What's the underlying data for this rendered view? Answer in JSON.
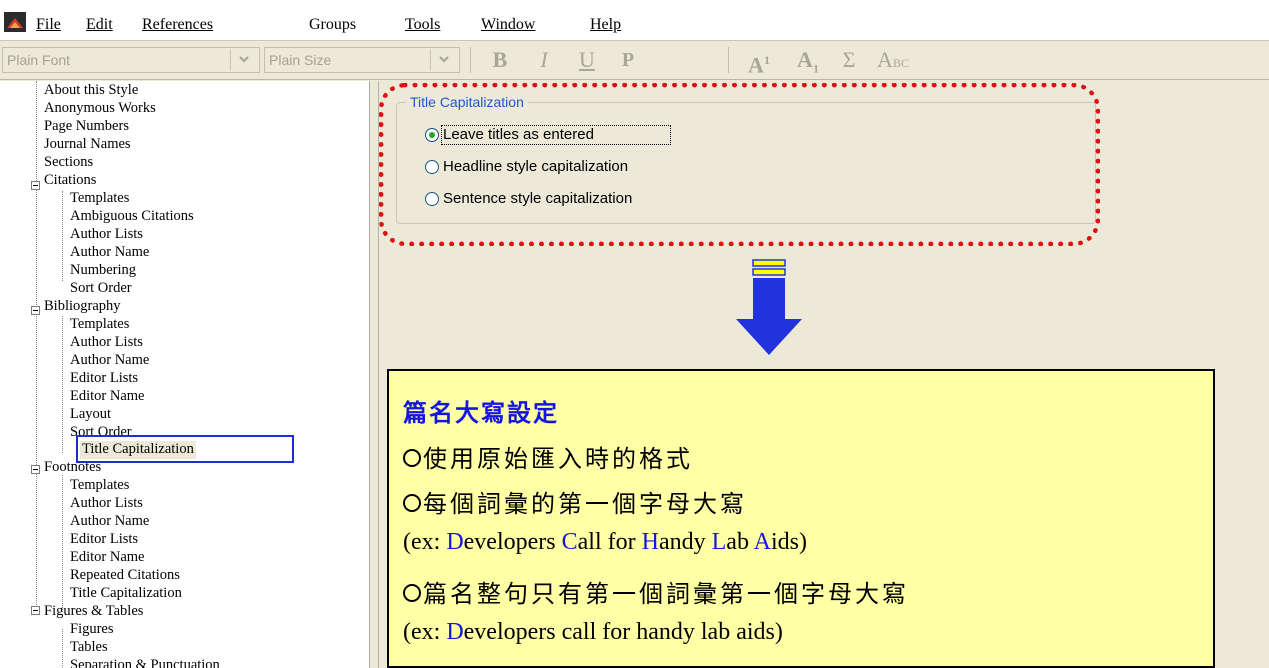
{
  "menu": {
    "items": [
      {
        "key": "file",
        "label": "File"
      },
      {
        "key": "edit",
        "label": "Edit"
      },
      {
        "key": "references",
        "label": "References"
      },
      {
        "key": "groups",
        "label": "Groups"
      },
      {
        "key": "tools",
        "label": "Tools"
      },
      {
        "key": "window",
        "label": "Window"
      },
      {
        "key": "help",
        "label": "Help"
      }
    ]
  },
  "toolbar": {
    "font_combo": "Plain Font",
    "size_combo": "Plain Size",
    "bold": "B",
    "italic": "I",
    "underline": "U",
    "plain": "P",
    "superscript": "A",
    "superscript_mark": "1",
    "subscript": "A",
    "subscript_mark": "1",
    "symbol": "Σ",
    "smallcaps_a": "A",
    "smallcaps_rest": "BC"
  },
  "tree": {
    "items": [
      "About this Style",
      "Anonymous Works",
      "Page Numbers",
      "Journal Names",
      "Sections",
      "Citations",
      "Templates",
      "Ambiguous Citations",
      "Author Lists",
      "Author Name",
      "Numbering",
      "Sort Order",
      "Bibliography",
      "Templates",
      "Author Lists",
      "Author Name",
      "Editor Lists",
      "Editor Name",
      "Layout",
      "Sort Order",
      "Title Capitalization",
      "Footnotes",
      "Templates",
      "Author Lists",
      "Author Name",
      "Editor Lists",
      "Editor Name",
      "Repeated Citations",
      "Title Capitalization",
      "Figures & Tables",
      "Figures",
      "Tables",
      "Separation & Punctuation"
    ],
    "selected": "Title Capitalization"
  },
  "panel": {
    "group_title": "Title Capitalization",
    "options": [
      {
        "label": "Leave titles as entered",
        "checked": true
      },
      {
        "label": "Headline style capitalization",
        "checked": false
      },
      {
        "label": "Sentence style capitalization",
        "checked": false
      }
    ]
  },
  "callout": {
    "title": "篇名大寫設定",
    "line1": "使用原始匯入時的格式",
    "line2": "每個詞彙的第一個字母大寫",
    "ex1": {
      "prefix": "(ex: ",
      "parts": [
        {
          "cap": "D",
          "rest": "evelopers "
        },
        {
          "cap": "C",
          "rest": "all for "
        },
        {
          "cap": "H",
          "rest": "andy "
        },
        {
          "cap": "L",
          "rest": "ab "
        },
        {
          "cap": "A",
          "rest": "ids)"
        }
      ]
    },
    "line3": "篇名整句只有第一個詞彙第一個字母大寫",
    "ex2": {
      "prefix": "(ex: ",
      "cap": "D",
      "rest": "evelopers call for handy lab aids)"
    }
  },
  "colors": {
    "accent_blue": "#1515e0",
    "highlight_red": "#e01010",
    "callout_bg": "#ffffa6",
    "arrow_blue": "#2233dd",
    "arrow_yellow": "#ffff00"
  }
}
